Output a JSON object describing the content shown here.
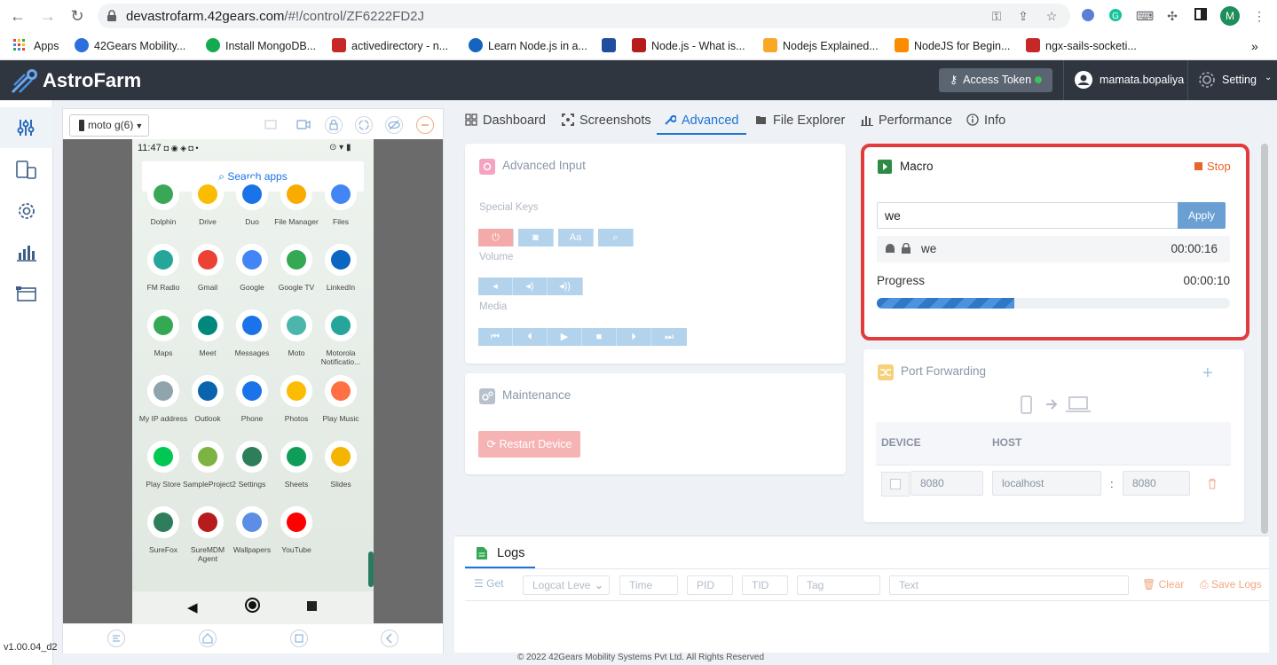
{
  "browser": {
    "url_host": "devastrofarm.42gears.com",
    "url_path": "/#!/control/ZF6222FD2J",
    "profile_initial": "M",
    "bookmarks": [
      {
        "label": "Apps",
        "color": "#ea4335"
      },
      {
        "label": "42Gears Mobility...",
        "color": "#2a6fdb"
      },
      {
        "label": "Install MongoDB...",
        "color": "#13aa52"
      },
      {
        "label": "activedirectory - n...",
        "color": "#c62828"
      },
      {
        "label": "Learn Node.js in a...",
        "color": "#1565c0"
      },
      {
        "label": "",
        "color": "#1e4e9c"
      },
      {
        "label": "Node.js - What is...",
        "color": "#b71c1c"
      },
      {
        "label": "Nodejs Explained...",
        "color": "#f9a825"
      },
      {
        "label": "NodeJS for Begin...",
        "color": "#fb8c00"
      },
      {
        "label": "ngx-sails-socketi...",
        "color": "#c62828"
      }
    ],
    "more_bookmarks": "»"
  },
  "header": {
    "app_name": "AstroFarm",
    "access_token_label": "Access Token",
    "username": "mamata.bopaliya",
    "setting_label": "Setting"
  },
  "device": {
    "model": "moto g(6)",
    "status_time": "11:47",
    "search_placeholder": "Search apps",
    "apps": [
      {
        "label": "Dolphin",
        "color": "#3aa757"
      },
      {
        "label": "Drive",
        "color": "#fbbc04"
      },
      {
        "label": "Duo",
        "color": "#1a73e8"
      },
      {
        "label": "File Manager",
        "color": "#f9ab00"
      },
      {
        "label": "Files",
        "color": "#4285f4"
      },
      {
        "label": "FM Radio",
        "color": "#26a69a"
      },
      {
        "label": "Gmail",
        "color": "#ea4335"
      },
      {
        "label": "Google",
        "color": "#4285f4"
      },
      {
        "label": "Google TV",
        "color": "#34a853"
      },
      {
        "label": "LinkedIn",
        "color": "#0a66c2"
      },
      {
        "label": "Maps",
        "color": "#34a853"
      },
      {
        "label": "Meet",
        "color": "#00897b"
      },
      {
        "label": "Messages",
        "color": "#1a73e8"
      },
      {
        "label": "Moto",
        "color": "#4db6ac"
      },
      {
        "label": "Motorola Notificatio...",
        "color": "#26a69a"
      },
      {
        "label": "My IP address",
        "color": "#90a4ae"
      },
      {
        "label": "Outlook",
        "color": "#0a64ad"
      },
      {
        "label": "Phone",
        "color": "#1a73e8"
      },
      {
        "label": "Photos",
        "color": "#fbbc04"
      },
      {
        "label": "Play Music",
        "color": "#ff7043"
      },
      {
        "label": "Play Store",
        "color": "#00c853"
      },
      {
        "label": "SampleProject2",
        "color": "#7cb342"
      },
      {
        "label": "Settings",
        "color": "#2e7d5b"
      },
      {
        "label": "Sheets",
        "color": "#0f9d58"
      },
      {
        "label": "Slides",
        "color": "#f4b400"
      },
      {
        "label": "SureFox",
        "color": "#2e7d5b"
      },
      {
        "label": "SureMDM Agent",
        "color": "#b71c1c"
      },
      {
        "label": "Wallpapers",
        "color": "#5c8ee6"
      },
      {
        "label": "YouTube",
        "color": "#ff0000"
      }
    ]
  },
  "version": "v1.00.04_d2",
  "tabs": [
    {
      "label": "Dashboard"
    },
    {
      "label": "Screenshots"
    },
    {
      "label": "Advanced"
    },
    {
      "label": "File Explorer"
    },
    {
      "label": "Performance"
    },
    {
      "label": "Info"
    }
  ],
  "advanced_input": {
    "title": "Advanced Input",
    "special_keys_label": "Special Keys",
    "volume_label": "Volume",
    "media_label": "Media",
    "aa_key": "Aa"
  },
  "maintenance": {
    "title": "Maintenance",
    "restart_label": "Restart Device"
  },
  "macro": {
    "title": "Macro",
    "stop_label": "Stop",
    "input_value": "we",
    "apply_label": "Apply",
    "running_name": "we",
    "running_time": "00:00:16",
    "progress_label": "Progress",
    "progress_time": "00:00:10",
    "progress_fraction": 0.39
  },
  "port_forwarding": {
    "title": "Port Forwarding",
    "col_device": "DEVICE",
    "col_host": "HOST",
    "device_port": "8080",
    "host_name": "localhost",
    "separator": ":",
    "host_port": "8080"
  },
  "logs": {
    "title": "Logs",
    "get_label": "Get",
    "logcat_placeholder": "Logcat Leve",
    "time_placeholder": "Time",
    "pid_placeholder": "PID",
    "tid_placeholder": "TID",
    "tag_placeholder": "Tag",
    "text_placeholder": "Text",
    "clear_label": "Clear",
    "save_label": "Save Logs"
  },
  "footer": {
    "copyright": "© 2022 42Gears Mobility Systems Pvt Ltd. All Rights Reserved"
  }
}
